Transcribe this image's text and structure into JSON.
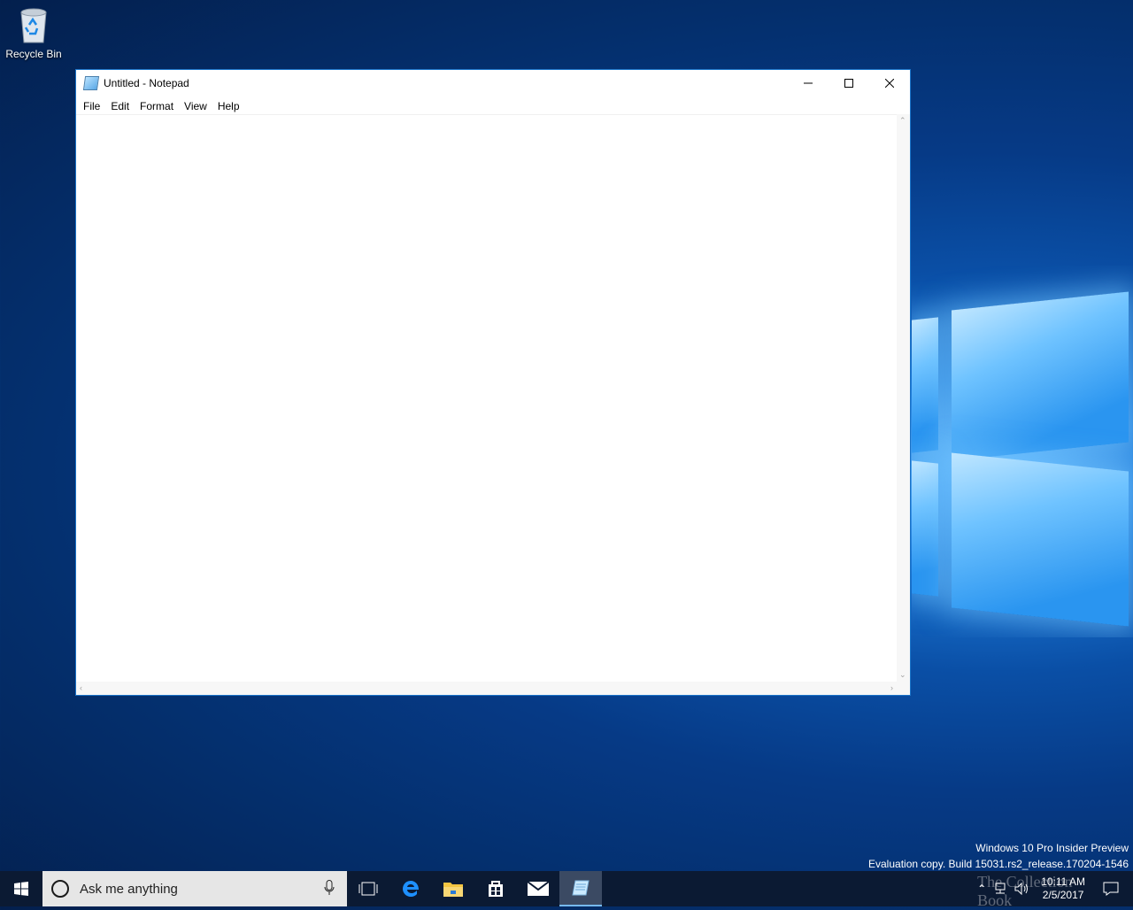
{
  "desktop": {
    "icons": [
      {
        "label": "Recycle Bin",
        "icon": "recycle-bin-icon"
      }
    ],
    "watermark": {
      "line1": "Windows 10 Pro Insider Preview",
      "line2": "Evaluation copy. Build 15031.rs2_release.170204-1546"
    },
    "brand_overlay": "The Collection Book"
  },
  "notepad": {
    "title": "Untitled - Notepad",
    "menu": [
      "File",
      "Edit",
      "Format",
      "View",
      "Help"
    ],
    "content": ""
  },
  "taskbar": {
    "search_placeholder": "Ask me anything",
    "pinned": [
      "task-view-icon",
      "edge-icon",
      "file-explorer-icon",
      "store-icon",
      "mail-icon",
      "notepad-icon"
    ],
    "clock": {
      "time": "10:11 AM",
      "date": "2/5/2017"
    }
  },
  "colors": {
    "accent": "#1a73c8",
    "taskbar": "#0b1a33",
    "search_bg": "#e6e6e6"
  }
}
